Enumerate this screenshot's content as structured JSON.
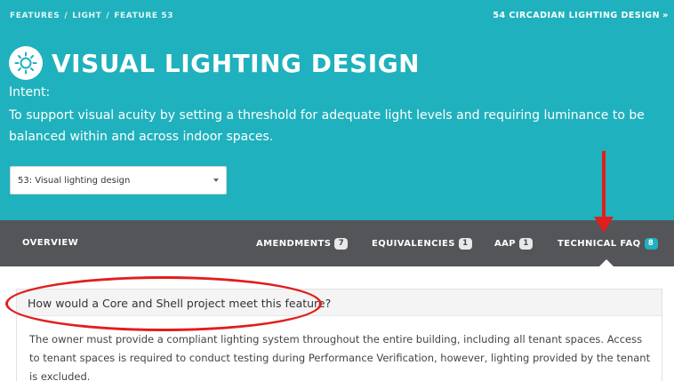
{
  "breadcrumb": [
    "FEATURES",
    "LIGHT",
    "FEATURE 53"
  ],
  "breadcrumb_sep": "/",
  "next_link": {
    "label": "54 CIRCADIAN LIGHTING DESIGN",
    "icon": "double-chevron-right-icon"
  },
  "title": {
    "icon": "light-sun-icon",
    "text": "VISUAL LIGHTING DESIGN"
  },
  "intent": {
    "label": "Intent:",
    "text": "To support visual acuity by setting a threshold for adequate light levels and requiring luminance to be balanced within and across indoor spaces."
  },
  "select": {
    "value": "53: Visual lighting design"
  },
  "tabs": [
    {
      "label": "OVERVIEW",
      "count": ""
    },
    {
      "label": "AMENDMENTS",
      "count": "7"
    },
    {
      "label": "EQUIVALENCIES",
      "count": "1"
    },
    {
      "label": "AAP",
      "count": "1"
    },
    {
      "label": "TECHNICAL FAQ",
      "count": "8",
      "active": true
    }
  ],
  "faq": {
    "question": "How would a Core and Shell project meet this feature?",
    "answer": "The owner must provide a compliant lighting system throughout the entire building, including all tenant spaces. Access to tenant spaces is required to conduct testing during Performance Verification, however, lighting provided by the tenant is excluded."
  },
  "colors": {
    "brand": "#1fb1bd",
    "tabbar": "#545558",
    "annotation": "#e21d1d"
  }
}
